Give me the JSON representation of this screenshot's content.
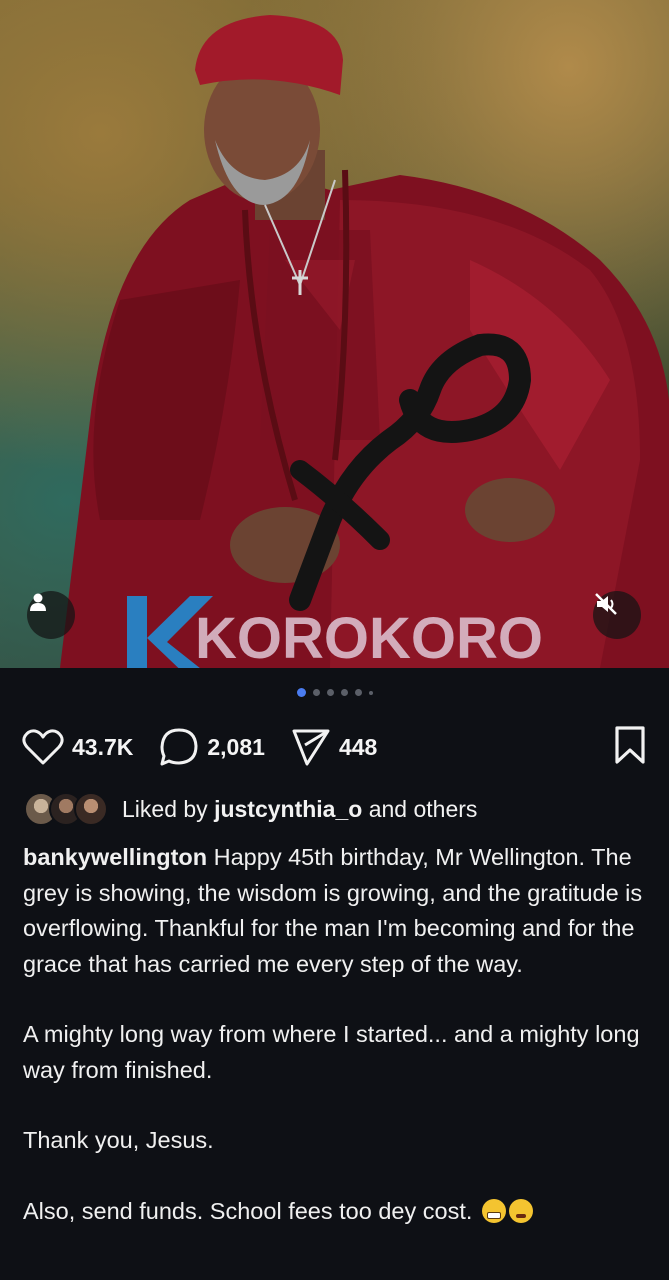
{
  "post": {
    "image_alt": "Portrait of a man in red traditional attire holding a black carved staff",
    "watermark": "KOROKORO",
    "carousel": {
      "count": 6,
      "active_index": 0
    }
  },
  "actions": {
    "likes": "43.7K",
    "comments": "2,081",
    "shares": "448"
  },
  "liked_by": {
    "prefix": "Liked by",
    "user": "justcynthia_o",
    "suffix": "and others"
  },
  "caption": {
    "username": "bankywellington",
    "para1": "Happy 45th birthday, Mr Wellington. The grey is showing, the wisdom is growing, and the gratitude is overflowing. Thankful for the man I'm becoming and for the grace that has carried me every step of the way.",
    "para2": "A mighty long way from where I started... and a mighty long way from finished.",
    "para3": "Thank you, Jesus.",
    "para4": "Also, send funds. School fees too dey cost."
  },
  "icons": {
    "person": "person-icon",
    "mute": "muted-speaker-icon",
    "like": "heart-icon",
    "comment": "comment-bubble-icon",
    "share": "send-icon",
    "save": "bookmark-icon"
  },
  "colors": {
    "background": "#0e1015",
    "carousel_active": "#4a7cf0",
    "robe": "#8b1424"
  }
}
